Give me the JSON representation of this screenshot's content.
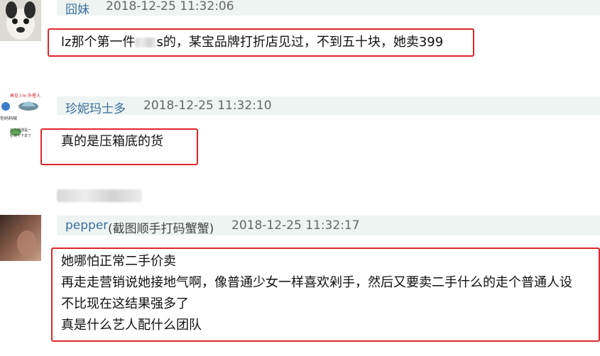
{
  "comments": [
    {
      "username": "囧妹",
      "time": "2018-12-25 11:32:06",
      "text_before": "lz那个第一件",
      "text_after": "s的，某宝品牌打折店见过，不到五十块，她卖399"
    },
    {
      "username": "珍妮玛士多",
      "time": "2018-12-25 11:32:10",
      "text": "真的是压箱底的货",
      "avatar_caption": [
        "再见 I'm 外星人",
        "你妈妈喊",
        "这个地球是一",
        "秒钟不下去了"
      ]
    },
    {
      "username": "pepper",
      "username_extra": "(截图顺手打码蟹蟹)",
      "time": "2018-12-25 11:32:17",
      "lines": [
        "她哪怕正常二手价卖",
        "再走走营销说她接地气啊，像普通少女一样喜欢剁手，然后又要卖二手什么的走个普通人设",
        "不比现在这结果强多了",
        "真是什么艺人配什么团队"
      ]
    }
  ],
  "colors": {
    "highlight": "#e0262b",
    "username": "#3a6f9a",
    "header_band": "#eef4f2"
  }
}
